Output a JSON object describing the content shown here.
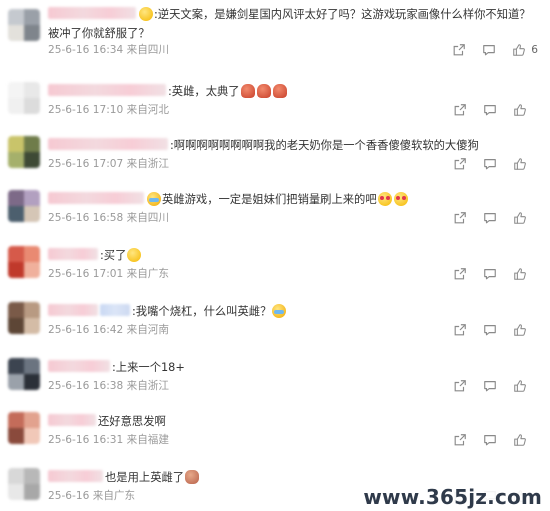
{
  "comments": [
    {
      "avatar_colors": [
        "#c5c9cf",
        "#9aa0a8",
        "#e3e1dc",
        "#7f858c"
      ],
      "name_style": "pink",
      "lead_emoji": "yellow-flower",
      "text": ":逆天文案，是嫌剑星国内风评太好了吗？这游戏玩家画像什么样你不知道？被冲了你就舒服了？",
      "time": "25-6-16 16:34",
      "location": "来自四川",
      "likes": "6"
    },
    {
      "avatar_colors": [
        "#f4f4f4",
        "#e8e8e8",
        "#f0f0f0",
        "#dcdcdc"
      ],
      "name_style": "pink",
      "text": ":英雌，太典了",
      "trail_emojis": [
        "red-face",
        "red-face",
        "red-face"
      ],
      "time": "25-6-16 17:10",
      "location": "来自河北",
      "likes": ""
    },
    {
      "avatar_colors": [
        "#c9c46a",
        "#6f7c4a",
        "#a5b06b",
        "#3e4a35"
      ],
      "name_style": "pink",
      "text": ":啊啊啊啊啊啊啊啊我的老天奶你是一个香香傻傻软软的大傻狗",
      "time": "25-6-16 17:07",
      "location": "来自浙江",
      "likes": ""
    },
    {
      "avatar_colors": [
        "#7d6a88",
        "#b2a0c0",
        "#4c5f6e",
        "#d5c6b6"
      ],
      "name_style": "pink",
      "lead_emoji": "crying",
      "text": "英雌游戏，一定是姐妹们把销量刷上来的吧",
      "trail_emojis": [
        "heart-eyes",
        "heart-eyes"
      ],
      "time": "25-6-16 16:58",
      "location": "来自四川",
      "likes": ""
    },
    {
      "avatar_colors": [
        "#d65a4a",
        "#e98a72",
        "#c0392b",
        "#f0b09c"
      ],
      "name_style": "pink",
      "text": ":买了",
      "trail_emojis": [
        "yellow-face"
      ],
      "time": "25-6-16 17:01",
      "location": "来自广东",
      "likes": ""
    },
    {
      "avatar_colors": [
        "#7a5a48",
        "#b89a82",
        "#5d4636",
        "#d4bca6"
      ],
      "name_style": "pink-blue",
      "text": ":我嘴个烧杠，什么叫英雌？",
      "trail_emojis": [
        "crying"
      ],
      "time": "25-6-16 16:42",
      "location": "来自河南",
      "likes": ""
    },
    {
      "avatar_colors": [
        "#3c4450",
        "#6b7480",
        "#9aa1aa",
        "#2b3038"
      ],
      "name_style": "pink",
      "text": ":上来一个18+",
      "time": "25-6-16 16:38",
      "location": "来自浙江",
      "likes": ""
    },
    {
      "avatar_colors": [
        "#c46c5a",
        "#e2a28e",
        "#8a4a3c",
        "#f1c8b8"
      ],
      "name_style": "pink",
      "text": "还好意思发啊",
      "time": "25-6-16 16:31",
      "location": "来自福建",
      "likes": ""
    },
    {
      "avatar_colors": [
        "#d8d8d8",
        "#b8b8b8",
        "#e8e8e8",
        "#a8a8a8"
      ],
      "name_style": "pink",
      "text": "也是用上英雌了",
      "trail_emojis": [
        "brown-bag"
      ],
      "time": "25-6-16",
      "location": "来自广东",
      "likes": ""
    }
  ],
  "watermark": "www.365jz.com",
  "colors": {
    "text": "#333333",
    "meta": "#9a9a9a",
    "icon": "#8a8a8a"
  }
}
